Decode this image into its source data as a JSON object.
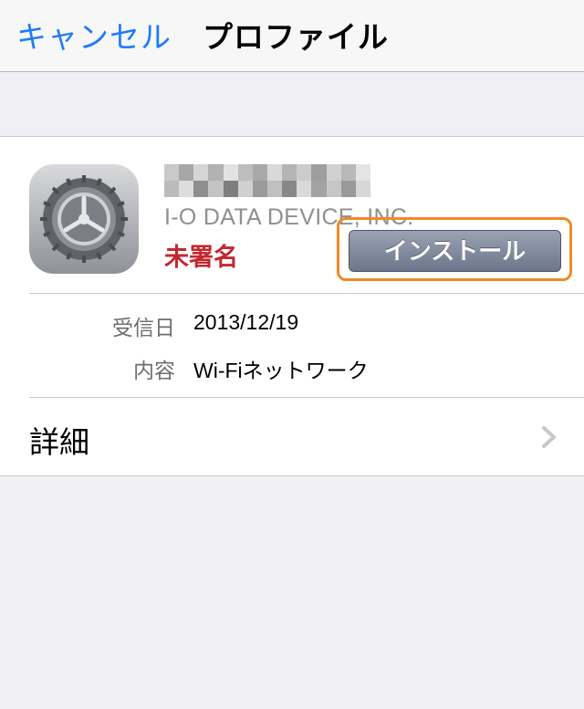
{
  "nav": {
    "cancel_label": "キャンセル",
    "title": "プロファイル"
  },
  "profile": {
    "icon": "settings-gear-icon",
    "company": "I-O DATA DEVICE, INC.",
    "signature_status": "未署名",
    "install_label": "インストール"
  },
  "details": [
    {
      "label": "受信日",
      "value": "2013/12/19"
    },
    {
      "label": "内容",
      "value": "Wi-Fiネットワーク"
    }
  ],
  "more": {
    "label": "詳細",
    "icon": "chevron-right-icon"
  },
  "colors": {
    "accent": "#1d7cf7",
    "unsigned": "#c2282f",
    "highlight": "#f08a24"
  }
}
